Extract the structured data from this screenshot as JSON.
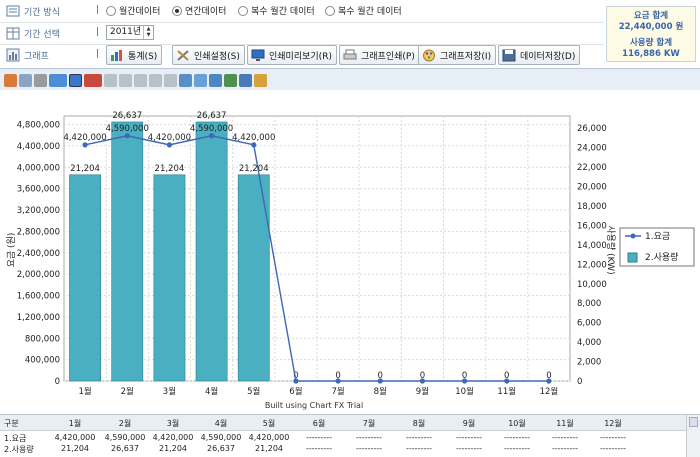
{
  "filters": {
    "period_type_label": "기간 방식",
    "period_options": [
      "월간데이터",
      "연간데이터",
      "복수 월간 데이터",
      "복수 월간 데이터"
    ],
    "selected_option": 1,
    "period_select_label": "기간 선택",
    "year_value": "2011년",
    "graph_label": "그래프"
  },
  "buttons": {
    "stats": "통계(S)",
    "print_settings": "인쇄설정(S)",
    "print_preview": "인쇄미리보기(R)",
    "graph_print": "그래프인쇄(P)",
    "graph_save": "그래프저장(I)",
    "data_save": "데이터저장(D)"
  },
  "summary": {
    "fee_total_label": "요금 합계",
    "fee_total_value": "22,440,000 원",
    "usage_total_label": "사용량 합계",
    "usage_total_value": "116,886 KW"
  },
  "colors": {
    "bar": "#4bafc2",
    "bar_stroke": "#2a7f90",
    "line": "#3f68b6",
    "accent_label": "#4a6d9a"
  },
  "chart_data": {
    "type": "bar",
    "categories": [
      "1월",
      "2월",
      "3월",
      "4월",
      "5월",
      "6월",
      "7월",
      "8월",
      "9월",
      "10월",
      "11월",
      "12월"
    ],
    "series": [
      {
        "name": "2.사용량",
        "kind": "bar",
        "axis": "right",
        "values": [
          21204,
          26637,
          21204,
          26637,
          21204,
          0,
          0,
          0,
          0,
          0,
          0,
          0
        ],
        "labels": [
          "21,204",
          "26,637",
          "21,204",
          "26,637",
          "21,204",
          "0",
          "0",
          "0",
          "0",
          "0",
          "0",
          "0"
        ]
      },
      {
        "name": "1.요금",
        "kind": "line",
        "axis": "left",
        "values": [
          4420000,
          4590000,
          4420000,
          4590000,
          4420000,
          0,
          0,
          0,
          0,
          0,
          0,
          0
        ],
        "labels": [
          "4,420,000",
          "4,590,000",
          "4,420,000",
          "4,590,000",
          "4,420,000",
          "0",
          "0",
          "0",
          "0",
          "0",
          "0",
          "0"
        ]
      }
    ],
    "left_ticks": [
      "4,800,000",
      "4,400,000",
      "4,000,000",
      "3,600,000",
      "3,200,000",
      "2,800,000",
      "2,400,000",
      "2,000,000",
      "1,600,000",
      "1,200,000",
      "800,000",
      "400,000",
      "0"
    ],
    "right_ticks": [
      "26,000",
      "24,000",
      "22,000",
      "20,000",
      "18,000",
      "16,000",
      "14,000",
      "12,000",
      "10,000",
      "8,000",
      "6,000",
      "4,000",
      "2,000",
      "0"
    ],
    "ylim_left": [
      0,
      4960000
    ],
    "ylim_right": [
      0,
      27250
    ],
    "ylabel": "요금 (원)",
    "ylabel_right": "사용량 (KW)",
    "watermark": "Built using Chart FX Trial",
    "legend_position": "right"
  },
  "table": {
    "header": [
      "구분",
      "1월",
      "2월",
      "3월",
      "4월",
      "5월",
      "6월",
      "7월",
      "8월",
      "9월",
      "10월",
      "11월",
      "12월"
    ],
    "rows": [
      [
        "1.요금",
        "4,420,000",
        "4,590,000",
        "4,420,000",
        "4,590,000",
        "4,420,000",
        "---------",
        "---------",
        "---------",
        "---------",
        "---------",
        "---------",
        "---------"
      ],
      [
        "2.사용량",
        "21,204",
        "26,637",
        "21,204",
        "26,637",
        "21,204",
        "---------",
        "---------",
        "---------",
        "---------",
        "---------",
        "---------",
        "---------"
      ]
    ]
  }
}
